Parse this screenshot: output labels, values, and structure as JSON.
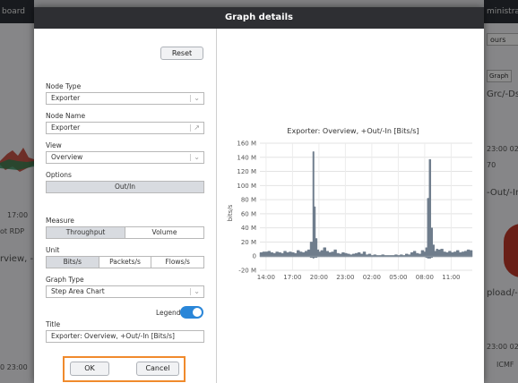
{
  "background": {
    "left_header": "board",
    "right_header": "ministrat",
    "left_texts": [
      "17:00",
      "ot RDP",
      "rview, -",
      "0  23:00"
    ],
    "right_texts": [
      "ours",
      "Graph",
      "Grc/-Dst",
      "23:00  02",
      "70",
      "-Out/-In",
      "pload/-D",
      "23:00  02",
      "ICMF"
    ]
  },
  "modal": {
    "title": "Graph details",
    "reset_label": "Reset",
    "node_type": {
      "label": "Node Type",
      "value": "Exporter"
    },
    "node_name": {
      "label": "Node Name",
      "value": "Exporter"
    },
    "view": {
      "label": "View",
      "value": "Overview"
    },
    "options": {
      "label": "Options",
      "button": "Out/In"
    },
    "measure": {
      "label": "Measure",
      "options": [
        "Throughput",
        "Volume"
      ],
      "selected": "Throughput"
    },
    "unit": {
      "label": "Unit",
      "options": [
        "Bits/s",
        "Packets/s",
        "Flows/s"
      ],
      "selected": "Bits/s"
    },
    "graph_type": {
      "label": "Graph Type",
      "value": "Step Area Chart"
    },
    "legend": {
      "label": "Legend",
      "on": true
    },
    "title_field": {
      "label": "Title",
      "value": "Exporter: Overview, +Out/-In [Bits/s]"
    },
    "ok_label": "OK",
    "cancel_label": "Cancel",
    "accent_color": "#2a86d8",
    "highlight_color": "#f08a2c"
  },
  "chart_data": {
    "type": "area",
    "title": "Exporter: Overview, +Out/-In [Bits/s]",
    "ylabel": "bits/s",
    "xlabel": "",
    "ylim": [
      -20,
      160
    ],
    "y_ticks": [
      "160 M",
      "140 M",
      "120 M",
      "100 M",
      "80 M",
      "60 M",
      "40 M",
      "20 M",
      "0",
      "-20 M"
    ],
    "y_tick_values": [
      160,
      140,
      120,
      100,
      80,
      60,
      40,
      20,
      0,
      -20
    ],
    "x_ticks": [
      "14:00",
      "17:00",
      "20:00",
      "23:00",
      "02:00",
      "05:00",
      "08:00",
      "11:00"
    ],
    "x_tick_hours": [
      14,
      17,
      20,
      23,
      26,
      29,
      32,
      35
    ],
    "x_range_hours": [
      13.3,
      37.4
    ],
    "grid": true,
    "series_color": "#6f7d8c",
    "series": [
      {
        "name": "",
        "x_hours": [
          13.3,
          13.6,
          13.9,
          14.2,
          14.5,
          14.8,
          15.1,
          15.4,
          15.7,
          16.0,
          16.3,
          16.6,
          16.9,
          17.2,
          17.5,
          17.8,
          18.1,
          18.4,
          18.7,
          19.0,
          19.3,
          19.45,
          19.6,
          19.8,
          20.0,
          20.2,
          20.5,
          20.8,
          21.1,
          21.4,
          21.7,
          22.0,
          22.3,
          22.6,
          22.9,
          23.2,
          23.5,
          23.8,
          24.1,
          24.4,
          24.7,
          25.0,
          25.3,
          25.6,
          25.9,
          26.2,
          26.5,
          26.8,
          27.1,
          27.4,
          27.7,
          28.0,
          28.3,
          28.6,
          28.9,
          29.2,
          29.5,
          29.8,
          30.1,
          30.4,
          30.7,
          31.0,
          31.3,
          31.6,
          31.9,
          32.1,
          32.3,
          32.5,
          32.7,
          32.9,
          33.1,
          33.3,
          33.5,
          33.8,
          34.1,
          34.4,
          34.7,
          35.0,
          35.3,
          35.6,
          35.9,
          36.2,
          36.5,
          36.8,
          37.1
        ],
        "values": [
          5,
          6,
          6,
          7,
          5,
          4,
          6,
          5,
          4,
          7,
          5,
          6,
          5,
          4,
          8,
          6,
          5,
          7,
          9,
          20,
          148,
          70,
          25,
          9,
          6,
          8,
          12,
          7,
          5,
          6,
          9,
          4,
          3,
          5,
          4,
          3,
          2,
          3,
          4,
          5,
          3,
          6,
          2,
          3,
          1,
          2,
          1,
          1,
          2,
          1,
          1,
          1,
          1,
          2,
          1,
          2,
          1,
          3,
          2,
          5,
          7,
          4,
          3,
          8,
          6,
          12,
          82,
          137,
          40,
          16,
          7,
          10,
          9,
          10,
          6,
          5,
          7,
          5,
          6,
          8,
          5,
          6,
          7,
          9,
          8
        ],
        "neg_values": [
          -1,
          -1,
          -1,
          -1,
          -1,
          -1,
          -1,
          -1,
          -1,
          -1,
          -1,
          -1,
          -1,
          -1,
          -1,
          -1,
          -1,
          -1,
          -1,
          -2,
          -3,
          -2,
          -2,
          -1,
          -1,
          -1,
          -1,
          -1,
          -1,
          -1,
          -1,
          -1,
          -1,
          -1,
          -1,
          -1,
          -1,
          -1,
          -1,
          -1,
          -1,
          -1,
          -1,
          -1,
          -1,
          -1,
          -1,
          -1,
          -1,
          -1,
          -1,
          -1,
          -1,
          -1,
          -1,
          -1,
          -1,
          -1,
          -1,
          -1,
          -1,
          -1,
          -1,
          -1,
          -1,
          -2,
          -3,
          -3,
          -2,
          -1,
          -1,
          -1,
          -1,
          -1,
          -1,
          -1,
          -1,
          -1,
          -1,
          -1,
          -1,
          -1,
          -1,
          -1,
          -1
        ]
      }
    ]
  }
}
